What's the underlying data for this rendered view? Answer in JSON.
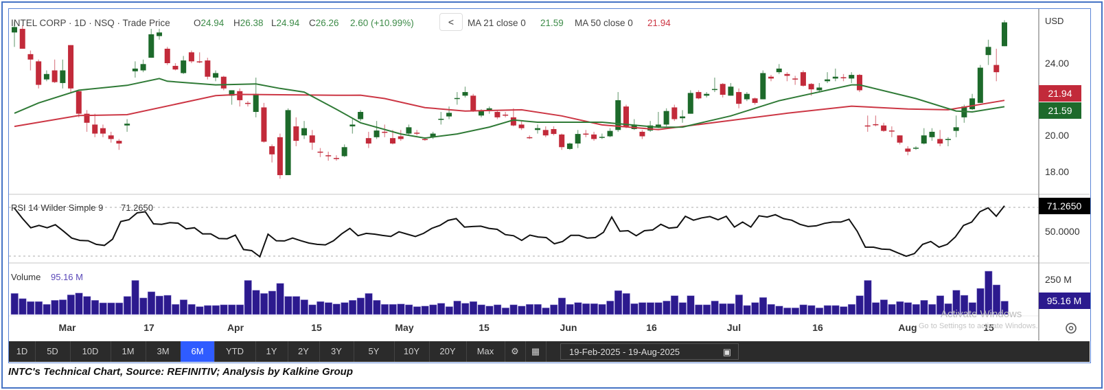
{
  "header": {
    "title": "INTEL CORP · 1D · NSQ · Trade Price",
    "ohlc": [
      {
        "label": "O",
        "value": "24.94"
      },
      {
        "label": "H",
        "value": "26.38"
      },
      {
        "label": "L",
        "value": "24.94"
      },
      {
        "label": "C",
        "value": "26.26"
      }
    ],
    "change": "2.60 (+10.99%)",
    "collapse_button": "<",
    "ma21_label": "MA 21 close 0",
    "ma21_value": "21.59",
    "ma50_label": "MA 50 close 0",
    "ma50_value": "21.94"
  },
  "axis": {
    "currency": "USD",
    "price_ticks": [
      "24.00",
      "20.00",
      "18.00"
    ],
    "price_tick_values": [
      24,
      20,
      18
    ],
    "ma50_badge": "21.94",
    "ma21_badge": "21.59",
    "rsi_badge": "71.2650",
    "rsi_mid": "50.0000",
    "volume_tick": "250 M",
    "volume_badge": "95.16 M"
  },
  "rsi": {
    "label": "RSI 14 Wilder Simple 9",
    "value": "71.2650"
  },
  "volume": {
    "label": "Volume",
    "value": "95.16 M"
  },
  "dates": [
    "Mar",
    "17",
    "Apr",
    "15",
    "May",
    "15",
    "Jun",
    "16",
    "Jul",
    "16",
    "Aug",
    "15"
  ],
  "watermark": {
    "line1": "Activate Windows",
    "line2": "Go to Settings to activate Windows."
  },
  "toolbar": {
    "ranges": [
      "1D",
      "5D",
      "10D",
      "1M",
      "3M",
      "6M",
      "YTD",
      "1Y",
      "2Y",
      "3Y",
      "5Y",
      "10Y",
      "20Y",
      "Max"
    ],
    "active": "6M",
    "date_range": "19-Feb-2025  -  19-Aug-2025"
  },
  "caption": "INTC's Technical Chart, Source: REFINITIV; Analysis by Kalkine Group",
  "colors": {
    "up": "#1d6a2b",
    "down": "#c22a3a",
    "ma21": "#2f7a36",
    "ma50": "#cc3644",
    "volume": "#2c1a8e",
    "accent": "#2f5cff"
  },
  "chart_data": {
    "type": "candlestick",
    "title": "INTEL CORP · 1D · NSQ · Trade Price",
    "period": "19-Feb-2025 to 19-Aug-2025",
    "ylim": [
      17.0,
      26.5
    ],
    "candles_ohlc": [
      [
        25.7,
        26.3,
        24.9,
        26.0
      ],
      [
        25.9,
        26.1,
        24.8,
        24.8
      ],
      [
        24.5,
        24.7,
        23.6,
        24.2
      ],
      [
        24.1,
        24.2,
        22.6,
        22.8
      ],
      [
        23.1,
        23.6,
        23.0,
        23.4
      ],
      [
        23.6,
        24.2,
        22.9,
        22.95
      ],
      [
        22.9,
        24.2,
        22.6,
        23.6
      ],
      [
        25.0,
        25.0,
        22.4,
        22.6
      ],
      [
        22.45,
        22.45,
        21.0,
        21.2
      ],
      [
        21.2,
        21.4,
        20.2,
        20.7
      ],
      [
        20.6,
        21.2,
        19.9,
        20.1
      ],
      [
        20.4,
        20.6,
        19.9,
        20.1
      ],
      [
        20.0,
        20.2,
        19.6,
        19.8
      ],
      [
        19.7,
        19.8,
        19.2,
        19.55
      ],
      [
        20.55,
        20.9,
        20.2,
        20.65
      ],
      [
        23.55,
        24.1,
        23.2,
        23.7
      ],
      [
        23.6,
        24.2,
        23.5,
        23.95
      ],
      [
        24.3,
        25.9,
        24.3,
        25.6
      ],
      [
        25.5,
        25.9,
        25.3,
        25.7
      ],
      [
        24.8,
        24.9,
        23.9,
        24.0
      ],
      [
        23.85,
        24.0,
        23.6,
        23.65
      ],
      [
        23.45,
        24.4,
        23.4,
        24.15
      ],
      [
        24.6,
        24.7,
        24.0,
        24.1
      ],
      [
        24.1,
        24.6,
        24.0,
        24.05
      ],
      [
        24.15,
        24.3,
        23.1,
        23.25
      ],
      [
        23.2,
        23.6,
        23.0,
        23.45
      ],
      [
        23.25,
        23.3,
        22.5,
        22.6
      ],
      [
        22.2,
        22.5,
        21.7,
        22.5
      ],
      [
        22.45,
        22.6,
        21.6,
        21.95
      ],
      [
        21.8,
        21.9,
        21.6,
        21.75
      ],
      [
        21.3,
        23.2,
        21.0,
        22.3
      ],
      [
        21.55,
        21.8,
        19.6,
        19.65
      ],
      [
        19.4,
        19.5,
        18.5,
        18.95
      ],
      [
        19.9,
        20.1,
        17.6,
        17.8
      ],
      [
        17.8,
        21.5,
        17.8,
        21.4
      ],
      [
        20.5,
        21.0,
        19.4,
        19.7
      ],
      [
        20.0,
        20.8,
        19.8,
        20.4
      ],
      [
        20.0,
        20.3,
        19.2,
        19.6
      ],
      [
        19.1,
        19.3,
        18.8,
        19.05
      ],
      [
        18.9,
        19.1,
        18.6,
        18.85
      ],
      [
        18.75,
        18.9,
        18.6,
        18.7
      ],
      [
        18.85,
        19.5,
        18.8,
        19.35
      ],
      [
        20.5,
        20.9,
        20.1,
        20.6
      ],
      [
        20.9,
        21.4,
        20.8,
        21.3
      ],
      [
        19.85,
        20.2,
        19.3,
        19.55
      ],
      [
        19.9,
        20.8,
        19.8,
        20.27
      ],
      [
        20.2,
        20.6,
        19.9,
        20.18
      ],
      [
        19.85,
        20.3,
        19.5,
        19.55
      ],
      [
        19.95,
        20.3,
        19.7,
        19.8
      ],
      [
        20.1,
        20.6,
        20.0,
        20.45
      ],
      [
        20.15,
        20.3,
        20.0,
        20.1
      ],
      [
        19.8,
        19.9,
        19.7,
        19.78
      ],
      [
        19.9,
        20.2,
        19.8,
        20.1
      ],
      [
        20.9,
        21.3,
        20.6,
        20.92
      ],
      [
        21.05,
        21.6,
        20.9,
        21.25
      ],
      [
        22.05,
        22.4,
        21.7,
        22.07
      ],
      [
        22.2,
        22.7,
        22.1,
        22.4
      ],
      [
        22.2,
        22.3,
        21.3,
        21.35
      ],
      [
        21.1,
        21.45,
        21.0,
        21.35
      ],
      [
        21.35,
        21.6,
        21.2,
        21.5
      ],
      [
        21.3,
        21.4,
        20.9,
        21.0
      ],
      [
        21.15,
        21.3,
        21.0,
        21.1
      ],
      [
        21.0,
        21.5,
        20.5,
        20.55
      ],
      [
        20.6,
        20.8,
        20.3,
        20.4
      ],
      [
        19.9,
        20.0,
        19.8,
        19.88
      ],
      [
        20.3,
        20.6,
        20.1,
        20.4
      ],
      [
        20.3,
        20.5,
        19.9,
        20.0
      ],
      [
        20.35,
        20.5,
        20.0,
        20.08
      ],
      [
        20.05,
        20.1,
        19.2,
        19.35
      ],
      [
        19.25,
        19.6,
        19.2,
        19.55
      ],
      [
        19.55,
        20.3,
        19.3,
        20.08
      ],
      [
        20.1,
        20.3,
        19.9,
        20.05
      ],
      [
        20.05,
        20.2,
        19.7,
        19.8
      ],
      [
        19.9,
        20.1,
        19.8,
        19.92
      ],
      [
        19.95,
        20.4,
        19.9,
        20.25
      ],
      [
        20.3,
        22.4,
        20.2,
        21.95
      ],
      [
        21.6,
        21.7,
        20.4,
        20.5
      ],
      [
        20.35,
        20.9,
        20.3,
        20.6
      ],
      [
        20.2,
        20.3,
        19.8,
        19.95
      ],
      [
        20.27,
        20.8,
        20.2,
        20.55
      ],
      [
        20.45,
        21.3,
        20.4,
        20.6
      ],
      [
        20.6,
        21.5,
        20.5,
        21.35
      ],
      [
        21.55,
        21.7,
        20.8,
        20.9
      ],
      [
        20.95,
        21.4,
        20.7,
        21.05
      ],
      [
        21.2,
        22.5,
        21.2,
        22.35
      ],
      [
        22.4,
        22.5,
        22.0,
        22.05
      ],
      [
        22.2,
        22.4,
        22.1,
        22.3
      ],
      [
        22.55,
        23.2,
        22.4,
        22.57
      ],
      [
        22.85,
        22.9,
        22.1,
        22.25
      ],
      [
        22.2,
        22.9,
        22.2,
        22.7
      ],
      [
        22.4,
        22.6,
        21.5,
        21.75
      ],
      [
        22.0,
        22.4,
        21.9,
        22.3
      ],
      [
        22.05,
        22.1,
        21.7,
        21.8
      ],
      [
        22.0,
        23.6,
        22.0,
        23.45
      ],
      [
        23.25,
        23.35,
        23.0,
        23.15
      ],
      [
        23.5,
        23.95,
        23.4,
        23.7
      ],
      [
        23.4,
        23.5,
        23.0,
        23.3
      ],
      [
        23.15,
        23.3,
        22.8,
        23.12
      ],
      [
        23.5,
        23.6,
        22.7,
        22.75
      ],
      [
        22.85,
        22.9,
        22.2,
        22.55
      ],
      [
        22.5,
        22.9,
        22.4,
        22.65
      ],
      [
        23.0,
        23.5,
        22.9,
        23.1
      ],
      [
        23.15,
        23.7,
        23.0,
        23.25
      ],
      [
        23.22,
        23.4,
        23.0,
        23.18
      ],
      [
        23.15,
        23.5,
        22.9,
        23.35
      ],
      [
        23.35,
        23.4,
        22.4,
        22.5
      ],
      [
        20.55,
        21.1,
        20.2,
        20.53
      ],
      [
        20.62,
        21.1,
        20.5,
        20.58
      ],
      [
        20.55,
        20.7,
        20.2,
        20.25
      ],
      [
        20.27,
        20.5,
        19.9,
        20.23
      ],
      [
        20.0,
        20.0,
        19.5,
        19.6
      ],
      [
        19.27,
        19.4,
        18.9,
        19.1
      ],
      [
        19.3,
        19.4,
        19.2,
        19.32
      ],
      [
        19.55,
        20.4,
        19.5,
        20.0
      ],
      [
        19.9,
        20.4,
        19.7,
        20.2
      ],
      [
        19.8,
        20.3,
        19.4,
        19.55
      ],
      [
        19.78,
        19.9,
        19.4,
        19.8
      ],
      [
        20.25,
        21.1,
        19.9,
        20.45
      ],
      [
        21.0,
        21.7,
        20.7,
        21.6
      ],
      [
        21.45,
        22.3,
        21.4,
        22.05
      ],
      [
        21.8,
        23.9,
        21.8,
        23.75
      ],
      [
        24.45,
        25.3,
        23.9,
        24.9
      ],
      [
        23.9,
        24.8,
        23.0,
        23.5
      ],
      [
        24.94,
        26.38,
        24.94,
        26.26
      ]
    ],
    "ma21_points": [
      [
        0,
        21.23
      ],
      [
        3,
        21.8
      ],
      [
        8,
        22.5
      ],
      [
        14,
        22.77
      ],
      [
        18,
        23.15
      ],
      [
        19,
        23.0
      ],
      [
        25,
        22.8
      ],
      [
        30,
        22.85
      ],
      [
        33,
        22.6
      ],
      [
        36,
        22.4
      ],
      [
        40,
        21.45
      ],
      [
        43,
        20.7
      ],
      [
        48,
        20.08
      ],
      [
        51,
        19.85
      ],
      [
        55,
        20.08
      ],
      [
        59,
        20.46
      ],
      [
        62,
        20.85
      ],
      [
        65,
        20.73
      ],
      [
        73,
        20.73
      ],
      [
        80,
        20.45
      ],
      [
        83,
        20.46
      ],
      [
        89,
        21.08
      ],
      [
        95,
        21.92
      ],
      [
        104,
        22.8
      ],
      [
        105,
        22.8
      ],
      [
        112,
        22.04
      ],
      [
        117,
        21.35
      ],
      [
        119,
        21.3
      ],
      [
        123,
        21.59
      ]
    ],
    "ma50_points": [
      [
        0,
        20.5
      ],
      [
        8,
        21.1
      ],
      [
        14,
        21.15
      ],
      [
        25,
        22.2
      ],
      [
        28,
        22.27
      ],
      [
        40,
        22.22
      ],
      [
        43,
        22.23
      ],
      [
        46,
        22.04
      ],
      [
        51,
        21.54
      ],
      [
        56,
        21.35
      ],
      [
        63,
        21.42
      ],
      [
        68,
        21.08
      ],
      [
        73,
        20.58
      ],
      [
        80,
        20.32
      ],
      [
        88,
        20.77
      ],
      [
        96,
        21.23
      ],
      [
        104,
        21.62
      ],
      [
        111,
        21.46
      ],
      [
        116,
        21.42
      ],
      [
        123,
        21.94
      ]
    ],
    "rsi": {
      "period": 14,
      "ylim": [
        30,
        70
      ],
      "levels": [
        30,
        50,
        70
      ],
      "values": [
        69.3,
        60.8,
        53.3,
        55.2,
        53.3,
        55.8,
        50.5,
        44.9,
        43.0,
        42.7,
        39.7,
        38.9,
        44.0,
        58.4,
        59.9,
        65.5,
        66.4,
        56.5,
        56.1,
        57.5,
        57.1,
        52.4,
        53.3,
        48.3,
        48.3,
        44.5,
        44.3,
        47.3,
        35.5,
        34.6,
        29.6,
        48.1,
        42.7,
        42.5,
        44.9,
        42.7,
        40.8,
        39.7,
        39.3,
        42.7,
        48.3,
        52.8,
        46.8,
        48.7,
        48.1,
        47.0,
        46.2,
        50.0,
        48.1,
        46.2,
        48.7,
        52.8,
        55.2,
        59.3,
        60.8,
        53.9,
        54.3,
        54.6,
        52.8,
        52.0,
        47.7,
        46.8,
        43.0,
        47.3,
        45.8,
        45.3,
        40.2,
        42.1,
        47.1,
        47.1,
        44.9,
        45.3,
        49.6,
        62.1,
        50.5,
        50.9,
        46.8,
        50.9,
        51.5,
        56.1,
        53.0,
        53.7,
        62.7,
        59.5,
        61.4,
        62.5,
        59.9,
        62.7,
        53.9,
        58.0,
        53.9,
        63.1,
        62.1,
        64.0,
        60.8,
        59.5,
        56.1,
        54.3,
        54.9,
        56.9,
        58.0,
        58.0,
        60.3,
        50.5,
        37.4,
        37.4,
        35.9,
        35.5,
        32.7,
        30.0,
        32.2,
        39.7,
        42.1,
        37.4,
        39.7,
        45.8,
        55.2,
        58.0,
        66.4,
        69.6,
        62.7,
        71.265
      ]
    },
    "volume_millions": [
      150,
      113,
      92,
      92,
      72,
      101,
      105,
      140,
      153,
      129,
      101,
      83,
      83,
      83,
      129,
      243,
      118,
      162,
      132,
      137,
      72,
      105,
      72,
      56,
      64,
      64,
      69,
      69,
      69,
      243,
      173,
      150,
      167,
      222,
      129,
      129,
      105,
      69,
      92,
      85,
      75,
      85,
      101,
      118,
      150,
      101,
      72,
      72,
      75,
      69,
      56,
      60,
      69,
      80,
      56,
      96,
      80,
      92,
      69,
      60,
      69,
      47,
      69,
      60,
      72,
      72,
      47,
      69,
      118,
      72,
      85,
      77,
      77,
      72,
      96,
      170,
      150,
      77,
      85,
      85,
      85,
      96,
      134,
      85,
      134,
      69,
      69,
      96,
      77,
      77,
      140,
      64,
      85,
      121,
      72,
      60,
      47,
      47,
      69,
      64,
      47,
      64,
      64,
      56,
      72,
      134,
      243,
      85,
      105,
      72,
      92,
      85,
      72,
      101,
      72,
      134,
      77,
      173,
      137,
      85,
      186,
      309,
      211,
      95.16
    ],
    "volume_ylim": [
      0,
      300
    ]
  }
}
